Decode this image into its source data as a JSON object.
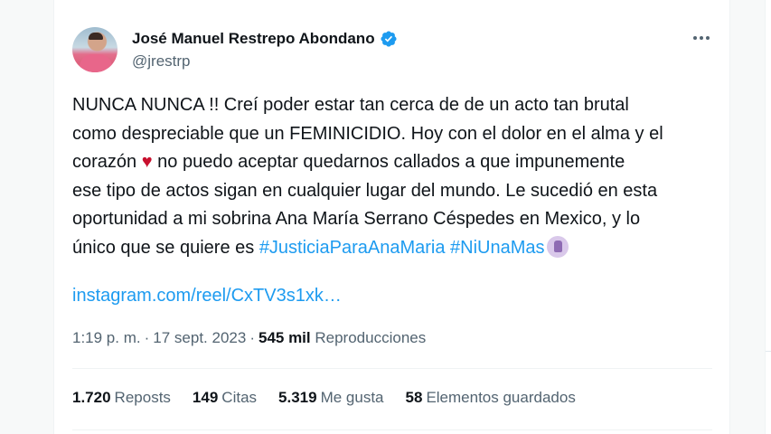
{
  "author": {
    "display_name": "José Manuel Restrepo Abondano",
    "handle": "@jrestrp"
  },
  "tweet": {
    "lines": [
      "NUNCA NUNCA !! Creí poder estar tan cerca de de un acto tan brutal",
      "como despreciable que un FEMINICIDIO. Hoy con el dolor en el alma y el",
      "corazón",
      "no puedo aceptar quedarnos callados a que impunemente",
      "ese tipo de actos sigan en cualquier lugar del mundo. Le sucedió en esta",
      "oportunidad a mi sobrina Ana María Serrano Céspedes en Mexico, y lo",
      "único que se quiere es"
    ],
    "heart_emoji": "♥",
    "hashtags": [
      "#JusticiaParaAnaMaria",
      "#NiUnaMas"
    ],
    "link": "instagram.com/reel/CxTV3s1xk…"
  },
  "meta": {
    "time": "1:19 p. m.",
    "date": "17 sept. 2023",
    "views_count": "545 mil",
    "views_label": "Reproducciones",
    "separator": "·"
  },
  "stats": [
    {
      "num": "1.720",
      "label": "Reposts"
    },
    {
      "num": "149",
      "label": "Citas"
    },
    {
      "num": "5.319",
      "label": "Me gusta"
    },
    {
      "num": "58",
      "label": "Elementos guardados"
    }
  ],
  "icons": {
    "verified": "verified-badge-icon",
    "more": "more-options-icon",
    "fist": "raised-fist-emoji-icon"
  },
  "colors": {
    "link": "#1d9bf0",
    "text": "#0f1419",
    "secondary": "#536471",
    "heart": "#c8102e"
  }
}
